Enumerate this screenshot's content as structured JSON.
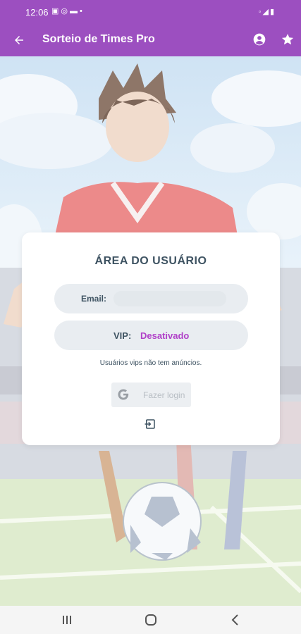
{
  "status_bar": {
    "time": "12:06",
    "notification_icons": [
      "image-icon",
      "whatsapp-icon",
      "chat-icon",
      "dot-icon"
    ],
    "system_icons": [
      "mute-icon",
      "signal-icon",
      "battery-icon"
    ]
  },
  "app_bar": {
    "title": "Sorteio de Times Pro",
    "background": "#9c4fc0"
  },
  "card": {
    "title": "ÁREA DO USUÁRIO",
    "email_label": "Email:",
    "vip_label": "VIP:",
    "vip_status": "Desativado",
    "vip_status_color": "#b040c8",
    "vip_note": "Usuários vips não tem anúncios.",
    "login_label": "Fazer login"
  },
  "nav_bar": {
    "icons": [
      "recents-icon",
      "home-icon",
      "back-icon"
    ]
  }
}
